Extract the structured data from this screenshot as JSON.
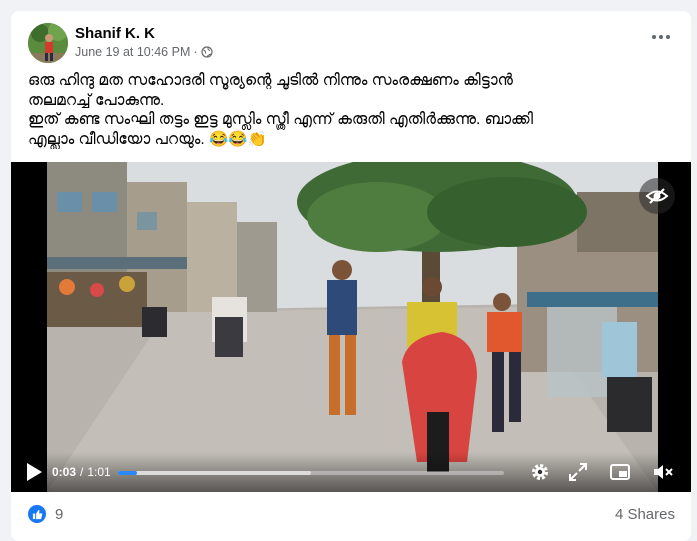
{
  "post": {
    "author": "Shanif K. K",
    "timestamp": "June 19 at 10:46 PM",
    "separator": "·",
    "audience_icon": "globe-icon",
    "text_lines": [
      "ഒരു ഹിന്ദു മത സഹോദരി സൂര്യന്റെ ചൂടിൽ നിന്നും സംരക്ഷണം കിട്ടാൻ",
      "തലമറച്ച് പോകുന്നു.",
      "ഇത് കണ്ട സംഘി തട്ടം ഇട്ട മുസ്ലിം സ്ത്രീ എന്ന് കരുതി എതിർക്കുന്നു. ബാക്കി",
      "എല്ലാം വീഡിയോ പറയും. 😂😂👏"
    ]
  },
  "video": {
    "current_time": "0:03",
    "time_sep": "/",
    "duration": "1:01",
    "progress_fraction": 0.05,
    "buffered_fraction": 0.5
  },
  "footer": {
    "reaction_count": "9",
    "shares": "4 Shares"
  },
  "colors": {
    "accent": "#1877f2",
    "progress": "#2d88ff",
    "secondary_text": "#65676b"
  }
}
